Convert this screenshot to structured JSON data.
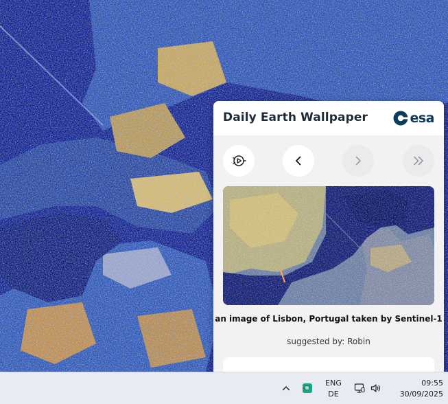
{
  "desktop": {
    "wallpaper": "radar-image-lisbon"
  },
  "widget": {
    "title": "Daily Earth Wallpaper",
    "logo_text": "esa",
    "controls": [
      {
        "name": "play-icon",
        "enabled": true
      },
      {
        "name": "chevron-left-icon",
        "enabled": true
      },
      {
        "name": "chevron-right-icon",
        "enabled": false
      },
      {
        "name": "double-chevron-right-icon",
        "enabled": false
      }
    ],
    "caption": "an image of Lisbon, Portugal taken by Sentinel-1",
    "suggested_by": "suggested by: Robin"
  },
  "taskbar": {
    "tray_icons": [
      "chevron-up-icon",
      "app-tray-icon",
      "network-icon",
      "volume-icon"
    ],
    "language": {
      "line1": "ENG",
      "line2": "DE"
    },
    "clock": {
      "time": "09:55",
      "date": "30/09/2025"
    }
  },
  "colors": {
    "accent_logo": "#0b3c5d",
    "panel_bg": "#f2f2f3",
    "taskbar_bg": "#e9ebf3",
    "app_icon": "#1ba487"
  }
}
